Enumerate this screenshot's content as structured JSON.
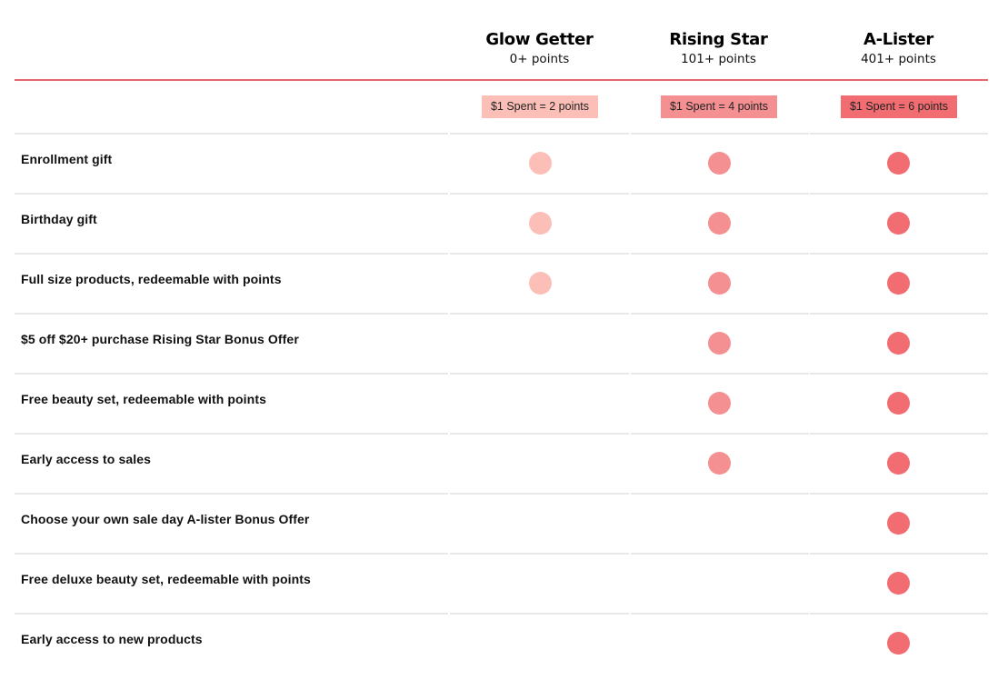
{
  "colors": {
    "accent_rule": "#e9676c",
    "glow_getter": "#fcbfb7",
    "rising_star": "#f48f92",
    "a_lister": "#f26d72",
    "divider": "#e8e8e8"
  },
  "tiers": [
    {
      "name": "Glow Getter",
      "points": "0+ points",
      "earn_rate": "$1 Spent = 2 points"
    },
    {
      "name": "Rising Star",
      "points": "101+ points",
      "earn_rate": "$1 Spent = 4 points"
    },
    {
      "name": "A-Lister",
      "points": "401+ points",
      "earn_rate": "$1 Spent = 6 points"
    }
  ],
  "benefits": [
    {
      "label": "Enrollment gift",
      "glow_getter": true,
      "rising_star": true,
      "a_lister": true
    },
    {
      "label": "Birthday gift",
      "glow_getter": true,
      "rising_star": true,
      "a_lister": true
    },
    {
      "label": "Full size products, redeemable with points",
      "glow_getter": true,
      "rising_star": true,
      "a_lister": true
    },
    {
      "label": "$5 off $20+ purchase Rising Star Bonus Offer",
      "glow_getter": false,
      "rising_star": true,
      "a_lister": true
    },
    {
      "label": "Free beauty set, redeemable with points",
      "glow_getter": false,
      "rising_star": true,
      "a_lister": true
    },
    {
      "label": "Early access to sales",
      "glow_getter": false,
      "rising_star": true,
      "a_lister": true
    },
    {
      "label": "Choose your own sale day A-lister Bonus Offer",
      "glow_getter": false,
      "rising_star": false,
      "a_lister": true
    },
    {
      "label": "Free deluxe beauty set, redeemable with points",
      "glow_getter": false,
      "rising_star": false,
      "a_lister": true
    },
    {
      "label": "Early access to new products",
      "glow_getter": false,
      "rising_star": false,
      "a_lister": true
    }
  ]
}
